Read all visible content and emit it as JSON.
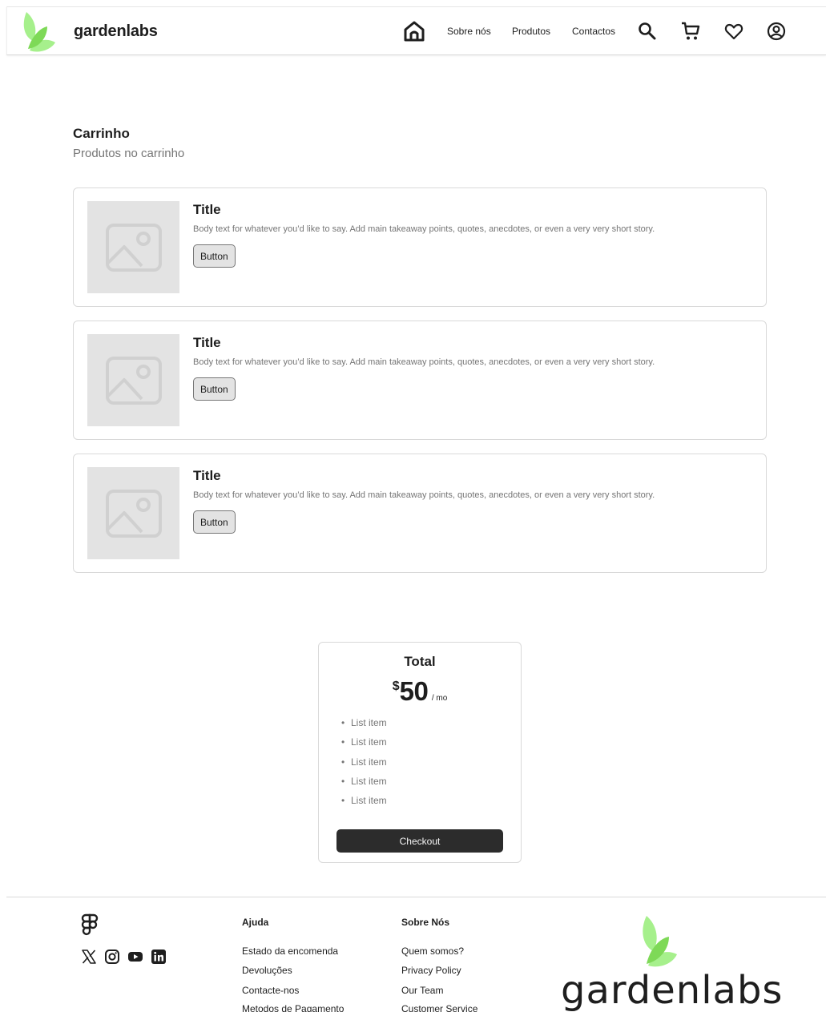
{
  "header": {
    "brand": "gardenlabs",
    "nav": {
      "about": "Sobre nós",
      "products": "Produtos",
      "contacts": "Contactos"
    }
  },
  "cart": {
    "title": "Carrinho",
    "subtitle": "Produtos no carrinho",
    "items": [
      {
        "title": "Title",
        "body": "Body text for whatever you’d like to say. Add main takeaway points, quotes, anecdotes, or even a very very short story.",
        "button": "Button"
      },
      {
        "title": "Title",
        "body": "Body text for whatever you’d like to say. Add main takeaway points, quotes, anecdotes, or even a very very short story.",
        "button": "Button"
      },
      {
        "title": "Title",
        "body": "Body text for whatever you’d like to say. Add main takeaway points, quotes, anecdotes, or even a very very short story.",
        "button": "Button"
      }
    ]
  },
  "total": {
    "title": "Total",
    "currency": "$",
    "amount": "50",
    "period": "/ mo",
    "list": [
      "List item",
      "List item",
      "List item",
      "List item",
      "List item"
    ],
    "checkout": "Checkout"
  },
  "footer": {
    "help": {
      "title": "Ajuda",
      "links": [
        "Estado da encomenda",
        "Devoluções",
        "Contacte-nos",
        "Metodos de Pagamento"
      ]
    },
    "about": {
      "title": "Sobre Nós",
      "links": [
        "Quem somos?",
        "Privacy Policy",
        "Our Team",
        "Customer Service"
      ]
    },
    "brand": "gardenlabs"
  },
  "colors": {
    "leaf_light": "#a6f08c",
    "leaf_dark": "#7ed957",
    "text": "#1e1e1e",
    "muted": "#757575",
    "border": "#d9d9d9",
    "checkout_bg": "#2c2c2c"
  }
}
